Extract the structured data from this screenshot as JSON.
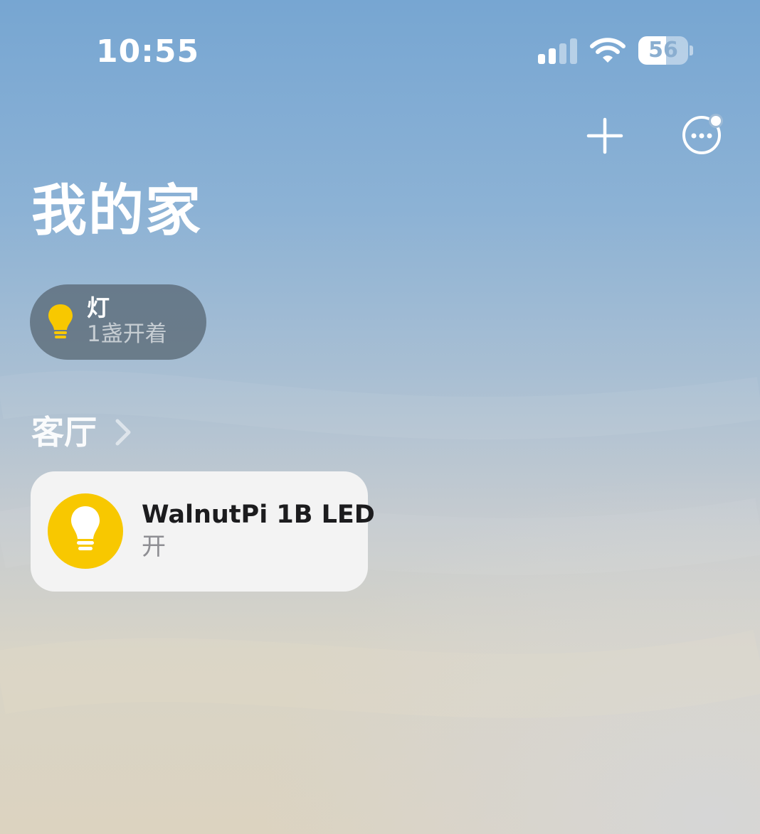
{
  "status_bar": {
    "time": "10:55",
    "battery_level": "56",
    "signal_icon": "cellular-signal-icon",
    "wifi_icon": "wifi-icon",
    "battery_icon": "battery-icon"
  },
  "toolbar": {
    "add_icon": "plus-icon",
    "more_icon": "ellipsis-circle-icon",
    "more_has_notification_dot": true
  },
  "page": {
    "title": "我的家"
  },
  "status_pill": {
    "icon": "lightbulb-icon",
    "title": "灯",
    "subtitle": "1盏开着"
  },
  "room": {
    "name": "客厅",
    "chevron_icon": "chevron-right-icon"
  },
  "devices": [
    {
      "name": "WalnutPi 1B LED",
      "state": "开",
      "icon": "lightbulb-icon",
      "on": true
    }
  ],
  "colors": {
    "accent_yellow": "#f8c800",
    "tile_background": "#f3f3f3",
    "pill_background": "#5a6976"
  }
}
